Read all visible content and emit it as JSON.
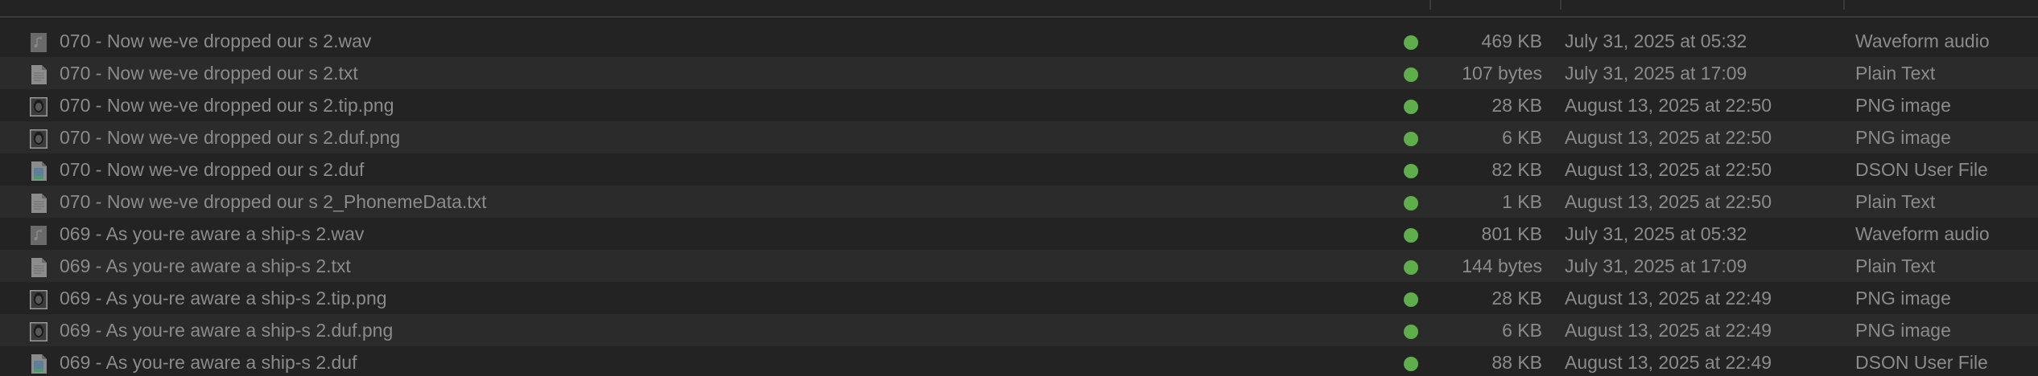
{
  "files": [
    {
      "name": "070 - Now we-ve dropped our s 2.wav",
      "size": "469 KB",
      "date": "July 31, 2025 at 05:32",
      "kind": "Waveform audio",
      "icon": "audio-file-icon",
      "tag": "#5fae4c"
    },
    {
      "name": "070 - Now we-ve dropped our s 2.txt",
      "size": "107 bytes",
      "date": "July 31, 2025 at 17:09",
      "kind": "Plain Text",
      "icon": "text-file-icon",
      "tag": "#5fae4c"
    },
    {
      "name": "070 - Now we-ve dropped our s 2.tip.png",
      "size": "28 KB",
      "date": "August 13, 2025 at 22:50",
      "kind": "PNG image",
      "icon": "png-thumbnail-icon",
      "tag": "#5fae4c"
    },
    {
      "name": "070 - Now we-ve dropped our s 2.duf.png",
      "size": "6 KB",
      "date": "August 13, 2025 at 22:50",
      "kind": "PNG image",
      "icon": "png-thumbnail-icon",
      "tag": "#5fae4c"
    },
    {
      "name": "070 - Now we-ve dropped our s 2.duf",
      "size": "82 KB",
      "date": "August 13, 2025 at 22:50",
      "kind": "DSON User File",
      "icon": "dson-file-icon",
      "tag": "#5fae4c"
    },
    {
      "name": "070 - Now we-ve dropped our s 2_PhonemeData.txt",
      "size": "1 KB",
      "date": "August 13, 2025 at 22:50",
      "kind": "Plain Text",
      "icon": "text-file-icon",
      "tag": "#5fae4c"
    },
    {
      "name": "069 - As you-re aware a ship-s 2.wav",
      "size": "801 KB",
      "date": "July 31, 2025 at 05:32",
      "kind": "Waveform audio",
      "icon": "audio-file-icon",
      "tag": "#5fae4c"
    },
    {
      "name": "069 - As you-re aware a ship-s 2.txt",
      "size": "144 bytes",
      "date": "July 31, 2025 at 17:09",
      "kind": "Plain Text",
      "icon": "text-file-icon",
      "tag": "#5fae4c"
    },
    {
      "name": "069 - As you-re aware a ship-s 2.tip.png",
      "size": "28 KB",
      "date": "August 13, 2025 at 22:49",
      "kind": "PNG image",
      "icon": "png-thumbnail-icon",
      "tag": "#5fae4c"
    },
    {
      "name": "069 - As you-re aware a ship-s 2.duf.png",
      "size": "6 KB",
      "date": "August 13, 2025 at 22:49",
      "kind": "PNG image",
      "icon": "png-thumbnail-icon",
      "tag": "#5fae4c"
    },
    {
      "name": "069 - As you-re aware a ship-s 2.duf",
      "size": "88 KB",
      "date": "August 13, 2025 at 22:49",
      "kind": "DSON User File",
      "icon": "dson-file-icon",
      "tag": "#5fae4c"
    }
  ]
}
